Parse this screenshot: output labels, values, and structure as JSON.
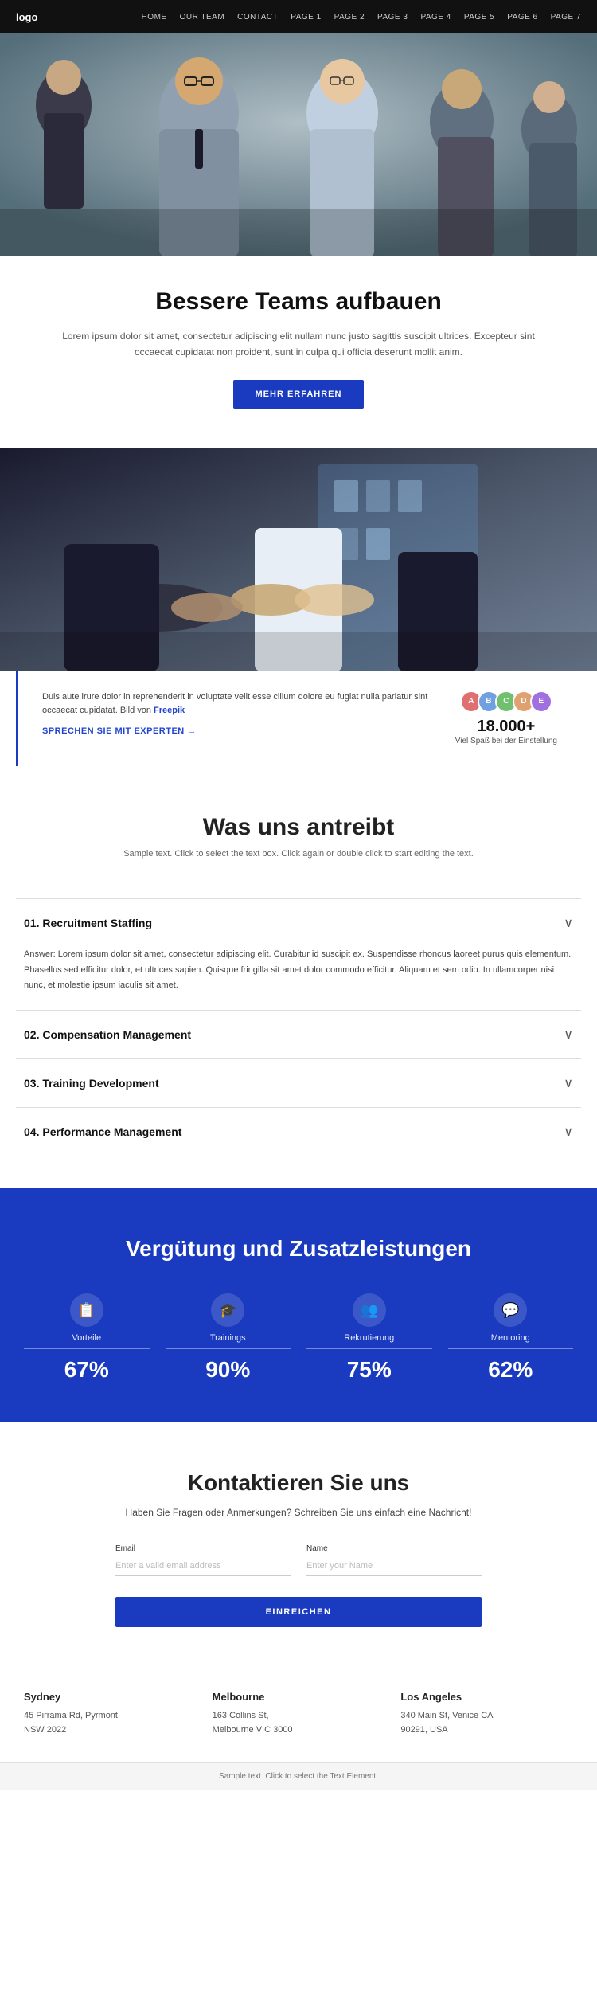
{
  "nav": {
    "logo": "logo",
    "links": [
      {
        "label": "HOME",
        "href": "#"
      },
      {
        "label": "OUR TEAM",
        "href": "#"
      },
      {
        "label": "CONTACT",
        "href": "#"
      },
      {
        "label": "PAGE 1",
        "href": "#"
      },
      {
        "label": "PAGE 2",
        "href": "#"
      },
      {
        "label": "PAGE 3",
        "href": "#"
      },
      {
        "label": "PAGE 4",
        "href": "#"
      },
      {
        "label": "PAGE 5",
        "href": "#"
      },
      {
        "label": "PAGE 6",
        "href": "#"
      },
      {
        "label": "PAGE 7",
        "href": "#"
      }
    ]
  },
  "hero": {
    "title": "Bessere Teams aufbauen",
    "description": "Lorem ipsum dolor sit amet, consectetur adipiscing elit nullam nunc justo sagittis suscipit ultrices. Excepteur sint occaecat cupidatat non proident, sunt in culpa qui officia deserunt mollit anim.",
    "button_label": "MEHR ERFAHREN"
  },
  "stats_row": {
    "text": "Duis aute irure dolor in reprehenderit in voluptate velit esse cillum dolore eu fugiat nulla pariatur sint occaecat cupidatat. Bild von",
    "link_text": "Freepik",
    "cta": "SPRECHEN SIE MIT EXPERTEN →",
    "number": "18.000+",
    "number_label": "Viel Spaß bei der Einstellung"
  },
  "antreibt": {
    "title": "Was uns antreibt",
    "subtitle": "Sample text. Click to select the text box. Click again or double click to start editing the text."
  },
  "accordion": {
    "items": [
      {
        "number": "01.",
        "title": "Recruitment Staffing",
        "content": "Answer: Lorem ipsum dolor sit amet, consectetur adipiscing elit. Curabitur id suscipit ex. Suspendisse rhoncus laoreet purus quis elementum. Phasellus sed efficitur dolor, et ultrices sapien. Quisque fringilla sit amet dolor commodo efficitur. Aliquam et sem odio. In ullamcorper nisi nunc, et molestie ipsum iaculis sit amet.",
        "open": true
      },
      {
        "number": "02.",
        "title": "Compensation Management",
        "content": "",
        "open": false
      },
      {
        "number": "03.",
        "title": "Training Development",
        "content": "",
        "open": false
      },
      {
        "number": "04.",
        "title": "Performance Management",
        "content": "",
        "open": false
      }
    ]
  },
  "blue_section": {
    "title": "Vergütung und Zusatzleistungen",
    "stats": [
      {
        "icon": "📋",
        "label": "Vorteile",
        "percent": "67%"
      },
      {
        "icon": "🎓",
        "label": "Trainings",
        "percent": "90%"
      },
      {
        "icon": "👥",
        "label": "Rekrutierung",
        "percent": "75%"
      },
      {
        "icon": "💬",
        "label": "Mentoring",
        "percent": "62%"
      }
    ]
  },
  "contact": {
    "title": "Kontaktieren Sie uns",
    "subtitle": "Haben Sie Fragen oder Anmerkungen? Schreiben Sie uns einfach eine Nachricht!",
    "email_label": "Email",
    "email_placeholder": "Enter a valid email address",
    "name_label": "Name",
    "name_placeholder": "Enter your Name",
    "submit_label": "EINREICHEN"
  },
  "locations": [
    {
      "city": "Sydney",
      "address": "45 Pirrama Rd, Pyrmont",
      "address2": "NSW 2022"
    },
    {
      "city": "Melbourne",
      "address": "163 Collins St,",
      "address2": "Melbourne VIC 3000"
    },
    {
      "city": "Los Angeles",
      "address": "340 Main St, Venice CA",
      "address2": "90291, USA"
    }
  ],
  "footer": {
    "note": "Sample text. Click to select the Text Element."
  }
}
